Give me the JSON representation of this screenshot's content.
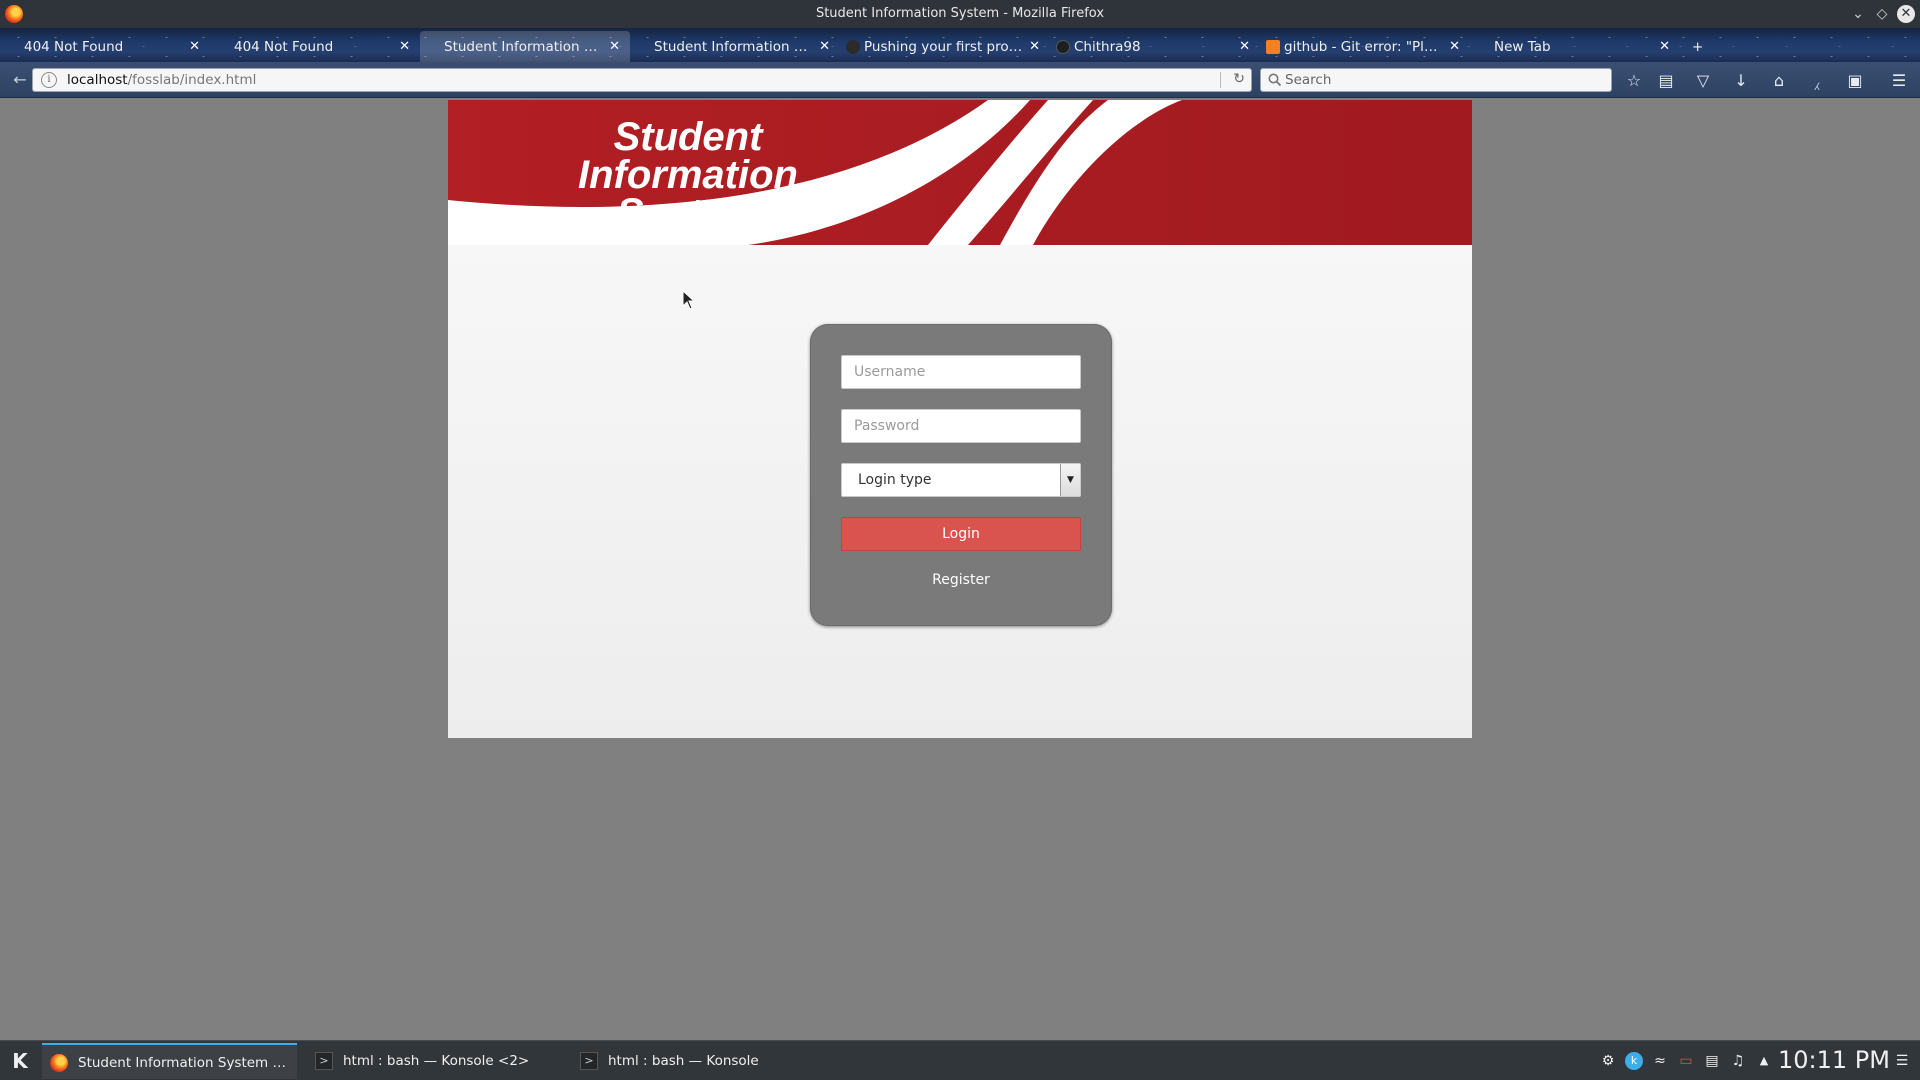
{
  "window": {
    "title": "Student Information System - Mozilla Firefox"
  },
  "tabs": [
    {
      "label": "404 Not Found",
      "active": false
    },
    {
      "label": "404 Not Found",
      "active": false
    },
    {
      "label": "Student Information System",
      "active": true
    },
    {
      "label": "Student Information System",
      "active": false
    },
    {
      "label": "Pushing your first proje...",
      "active": false
    },
    {
      "label": "Chithra98",
      "active": false
    },
    {
      "label": "github - Git error: \"Pleas...",
      "active": false
    },
    {
      "label": "New Tab",
      "active": false
    }
  ],
  "navbar": {
    "url_host": "localhost",
    "url_path": "/fosslab/index.html",
    "search_placeholder": "Search"
  },
  "banner": {
    "title_line1": "Student",
    "title_line2": "Information",
    "title_line3": "System",
    "color_primary": "#b01e23",
    "color_stripe": "#ffffff"
  },
  "login": {
    "username_placeholder": "Username",
    "password_placeholder": "Password",
    "login_type_value": "Login type",
    "login_button": "Login",
    "register_link": "Register",
    "button_color": "#d9534f"
  },
  "taskbar": {
    "tasks": [
      {
        "label": "Student Information System - Mozil...",
        "icon": "firefox-icon",
        "active": true
      },
      {
        "label": "html : bash — Konsole <2>",
        "icon": "terminal-icon",
        "active": false
      },
      {
        "label": "html : bash — Konsole",
        "icon": "terminal-icon",
        "active": false
      }
    ],
    "clock": "10:11 PM"
  }
}
